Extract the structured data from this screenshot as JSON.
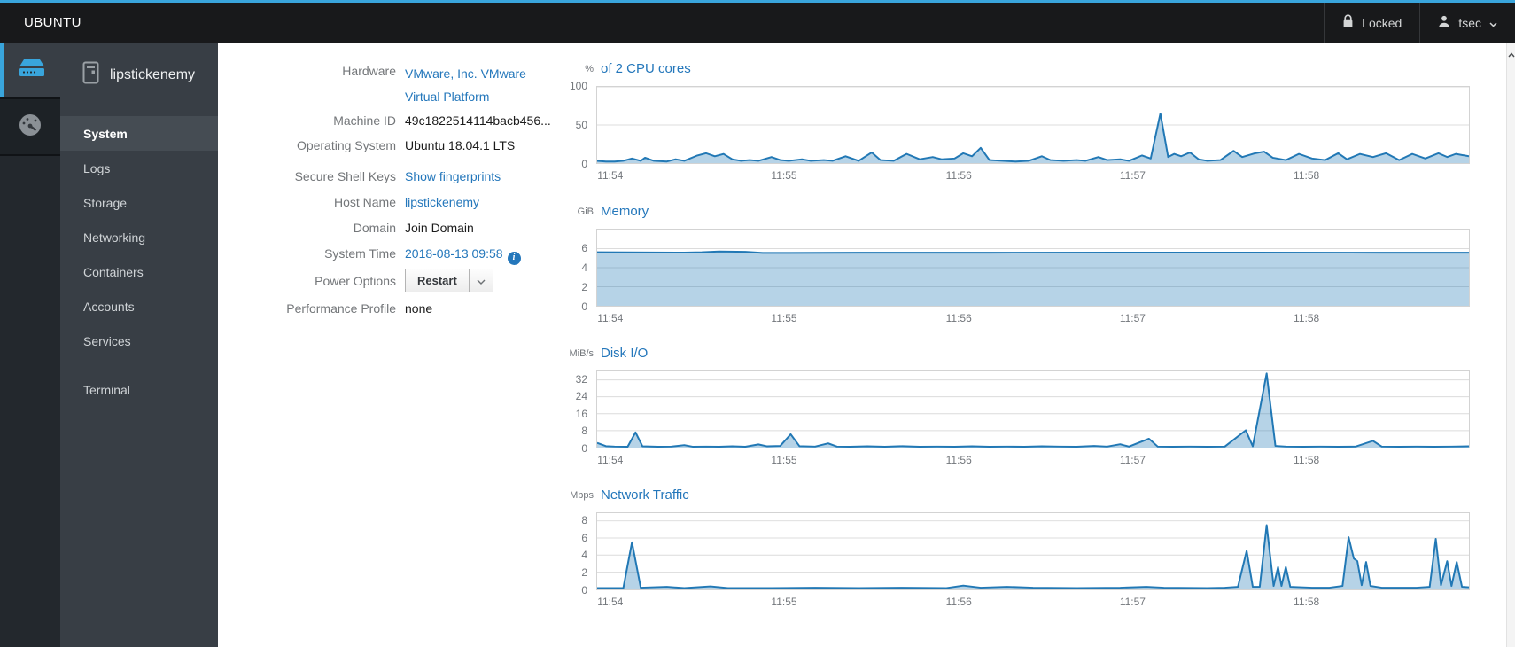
{
  "topbar": {
    "brand": "UBUNTU",
    "locked_label": "Locked",
    "user": "tsec"
  },
  "sidebar": {
    "hostname": "lipstickenemy",
    "items": [
      "System",
      "Logs",
      "Storage",
      "Networking",
      "Containers",
      "Accounts",
      "Services",
      "Terminal"
    ],
    "active_item": "System"
  },
  "info": {
    "hardware_label": "Hardware",
    "hardware_value": "VMware, Inc. VMware Virtual Platform",
    "machine_id_label": "Machine ID",
    "machine_id_value": "49c1822514114bacb456...",
    "os_label": "Operating System",
    "os_value": "Ubuntu 18.04.1 LTS",
    "ssh_label": "Secure Shell Keys",
    "ssh_value": "Show fingerprints",
    "hostname_label": "Host Name",
    "hostname_value": "lipstickenemy",
    "domain_label": "Domain",
    "domain_value": "Join Domain",
    "time_label": "System Time",
    "time_value": "2018-08-13 09:58",
    "power_label": "Power Options",
    "power_button": "Restart",
    "profile_label": "Performance Profile",
    "profile_value": "none"
  },
  "icons": {
    "info_glyph": "i"
  },
  "colors": {
    "accent_blue": "#39a5dc",
    "link_blue": "#2477bb",
    "chart_line": "#2178b5",
    "chart_fill": "rgba(33,120,181,0.33)"
  },
  "chart_data": [
    {
      "type": "area",
      "unit": "%",
      "title": "of 2 CPU cores",
      "ymax": 100,
      "yticks": [
        0,
        50,
        100
      ],
      "xticks": [
        {
          "label": "11:54",
          "f": 0.016
        },
        {
          "label": "11:55",
          "f": 0.215
        },
        {
          "label": "11:56",
          "f": 0.415
        },
        {
          "label": "11:57",
          "f": 0.614
        },
        {
          "label": "11:58",
          "f": 0.813
        }
      ],
      "line_color": "#2178b5",
      "fill_color": "rgba(33,120,181,0.33)",
      "series": [
        [
          0,
          3
        ],
        [
          0.01,
          2
        ],
        [
          0.02,
          2
        ],
        [
          0.03,
          3
        ],
        [
          0.04,
          6
        ],
        [
          0.05,
          3
        ],
        [
          0.055,
          7
        ],
        [
          0.065,
          3
        ],
        [
          0.08,
          2
        ],
        [
          0.09,
          5
        ],
        [
          0.1,
          3
        ],
        [
          0.115,
          10
        ],
        [
          0.125,
          13
        ],
        [
          0.135,
          9
        ],
        [
          0.145,
          12
        ],
        [
          0.155,
          5
        ],
        [
          0.165,
          3
        ],
        [
          0.175,
          4
        ],
        [
          0.185,
          3
        ],
        [
          0.2,
          8
        ],
        [
          0.21,
          4
        ],
        [
          0.22,
          3
        ],
        [
          0.235,
          5
        ],
        [
          0.245,
          3
        ],
        [
          0.26,
          4
        ],
        [
          0.27,
          3
        ],
        [
          0.285,
          9
        ],
        [
          0.3,
          3
        ],
        [
          0.315,
          14
        ],
        [
          0.325,
          4
        ],
        [
          0.34,
          3
        ],
        [
          0.355,
          12
        ],
        [
          0.37,
          5
        ],
        [
          0.385,
          8
        ],
        [
          0.395,
          5
        ],
        [
          0.41,
          6
        ],
        [
          0.42,
          13
        ],
        [
          0.43,
          9
        ],
        [
          0.44,
          20
        ],
        [
          0.45,
          4
        ],
        [
          0.465,
          3
        ],
        [
          0.48,
          2
        ],
        [
          0.495,
          3
        ],
        [
          0.51,
          9
        ],
        [
          0.52,
          4
        ],
        [
          0.535,
          3
        ],
        [
          0.55,
          4
        ],
        [
          0.56,
          3
        ],
        [
          0.575,
          8
        ],
        [
          0.585,
          4
        ],
        [
          0.6,
          5
        ],
        [
          0.61,
          3
        ],
        [
          0.625,
          10
        ],
        [
          0.635,
          6
        ],
        [
          0.646,
          65
        ],
        [
          0.655,
          8
        ],
        [
          0.662,
          12
        ],
        [
          0.67,
          9
        ],
        [
          0.68,
          14
        ],
        [
          0.69,
          5
        ],
        [
          0.7,
          3
        ],
        [
          0.715,
          4
        ],
        [
          0.73,
          16
        ],
        [
          0.74,
          8
        ],
        [
          0.755,
          13
        ],
        [
          0.765,
          15
        ],
        [
          0.775,
          7
        ],
        [
          0.79,
          4
        ],
        [
          0.805,
          12
        ],
        [
          0.82,
          6
        ],
        [
          0.835,
          4
        ],
        [
          0.85,
          13
        ],
        [
          0.86,
          5
        ],
        [
          0.875,
          12
        ],
        [
          0.89,
          8
        ],
        [
          0.905,
          13
        ],
        [
          0.92,
          4
        ],
        [
          0.935,
          12
        ],
        [
          0.95,
          6
        ],
        [
          0.965,
          13
        ],
        [
          0.975,
          8
        ],
        [
          0.985,
          12
        ],
        [
          1,
          9
        ]
      ]
    },
    {
      "type": "area",
      "unit": "GiB",
      "title": "Memory",
      "ymax": 8,
      "yticks": [
        0,
        2,
        4,
        6
      ],
      "xticks": [
        {
          "label": "11:54",
          "f": 0.016
        },
        {
          "label": "11:55",
          "f": 0.215
        },
        {
          "label": "11:56",
          "f": 0.415
        },
        {
          "label": "11:57",
          "f": 0.614
        },
        {
          "label": "11:58",
          "f": 0.813
        }
      ],
      "line_color": "#2178b5",
      "fill_color": "rgba(33,120,181,0.33)",
      "series": [
        [
          0,
          5.62
        ],
        [
          0.06,
          5.6
        ],
        [
          0.1,
          5.58
        ],
        [
          0.12,
          5.62
        ],
        [
          0.14,
          5.7
        ],
        [
          0.17,
          5.66
        ],
        [
          0.19,
          5.55
        ],
        [
          0.22,
          5.55
        ],
        [
          0.3,
          5.57
        ],
        [
          0.45,
          5.57
        ],
        [
          0.6,
          5.58
        ],
        [
          0.75,
          5.58
        ],
        [
          0.9,
          5.57
        ],
        [
          1,
          5.57
        ]
      ]
    },
    {
      "type": "area",
      "unit": "MiB/s",
      "title": "Disk I/O",
      "ymax": 36,
      "yticks": [
        0,
        8,
        16,
        24,
        32
      ],
      "xticks": [
        {
          "label": "11:54",
          "f": 0.016
        },
        {
          "label": "11:55",
          "f": 0.215
        },
        {
          "label": "11:56",
          "f": 0.415
        },
        {
          "label": "11:57",
          "f": 0.614
        },
        {
          "label": "11:58",
          "f": 0.813
        }
      ],
      "line_color": "#2178b5",
      "fill_color": "rgba(33,120,181,0.33)",
      "series": [
        [
          0,
          2.2
        ],
        [
          0.01,
          0.7
        ],
        [
          0.02,
          0.5
        ],
        [
          0.035,
          0.4
        ],
        [
          0.044,
          7.2
        ],
        [
          0.052,
          0.6
        ],
        [
          0.07,
          0.4
        ],
        [
          0.085,
          0.5
        ],
        [
          0.1,
          1.2
        ],
        [
          0.11,
          0.4
        ],
        [
          0.125,
          0.5
        ],
        [
          0.14,
          0.4
        ],
        [
          0.155,
          0.6
        ],
        [
          0.17,
          0.4
        ],
        [
          0.185,
          1.5
        ],
        [
          0.195,
          0.6
        ],
        [
          0.21,
          0.8
        ],
        [
          0.222,
          6.3
        ],
        [
          0.232,
          0.7
        ],
        [
          0.25,
          0.5
        ],
        [
          0.265,
          2
        ],
        [
          0.275,
          0.5
        ],
        [
          0.29,
          0.4
        ],
        [
          0.31,
          0.6
        ],
        [
          0.33,
          0.4
        ],
        [
          0.35,
          0.7
        ],
        [
          0.37,
          0.4
        ],
        [
          0.39,
          0.5
        ],
        [
          0.41,
          0.4
        ],
        [
          0.43,
          0.6
        ],
        [
          0.45,
          0.4
        ],
        [
          0.47,
          0.5
        ],
        [
          0.49,
          0.4
        ],
        [
          0.51,
          0.6
        ],
        [
          0.53,
          0.5
        ],
        [
          0.55,
          0.4
        ],
        [
          0.57,
          0.8
        ],
        [
          0.585,
          0.5
        ],
        [
          0.6,
          1.6
        ],
        [
          0.61,
          0.5
        ],
        [
          0.633,
          4.2
        ],
        [
          0.643,
          0.5
        ],
        [
          0.66,
          0.4
        ],
        [
          0.68,
          0.5
        ],
        [
          0.7,
          0.4
        ],
        [
          0.72,
          0.5
        ],
        [
          0.744,
          8.2
        ],
        [
          0.752,
          0.6
        ],
        [
          0.768,
          35
        ],
        [
          0.778,
          0.8
        ],
        [
          0.79,
          0.5
        ],
        [
          0.81,
          0.4
        ],
        [
          0.83,
          0.5
        ],
        [
          0.85,
          0.4
        ],
        [
          0.87,
          0.5
        ],
        [
          0.89,
          3.2
        ],
        [
          0.9,
          0.5
        ],
        [
          0.92,
          0.4
        ],
        [
          0.94,
          0.5
        ],
        [
          0.96,
          0.4
        ],
        [
          0.98,
          0.5
        ],
        [
          1,
          0.6
        ]
      ]
    },
    {
      "type": "area",
      "unit": "Mbps",
      "title": "Network Traffic",
      "ymax": 8.9,
      "yticks": [
        0,
        2,
        4,
        6,
        8
      ],
      "xticks": [
        {
          "label": "11:54",
          "f": 0.016
        },
        {
          "label": "11:55",
          "f": 0.215
        },
        {
          "label": "11:56",
          "f": 0.415
        },
        {
          "label": "11:57",
          "f": 0.614
        },
        {
          "label": "11:58",
          "f": 0.813
        }
      ],
      "line_color": "#2178b5",
      "fill_color": "rgba(33,120,181,0.33)",
      "series": [
        [
          0,
          0.15
        ],
        [
          0.03,
          0.15
        ],
        [
          0.04,
          5.5
        ],
        [
          0.05,
          0.2
        ],
        [
          0.08,
          0.3
        ],
        [
          0.1,
          0.15
        ],
        [
          0.13,
          0.35
        ],
        [
          0.15,
          0.15
        ],
        [
          0.2,
          0.15
        ],
        [
          0.25,
          0.2
        ],
        [
          0.3,
          0.15
        ],
        [
          0.35,
          0.2
        ],
        [
          0.4,
          0.15
        ],
        [
          0.42,
          0.45
        ],
        [
          0.44,
          0.2
        ],
        [
          0.47,
          0.3
        ],
        [
          0.5,
          0.2
        ],
        [
          0.55,
          0.15
        ],
        [
          0.6,
          0.2
        ],
        [
          0.63,
          0.3
        ],
        [
          0.65,
          0.2
        ],
        [
          0.7,
          0.15
        ],
        [
          0.72,
          0.2
        ],
        [
          0.735,
          0.3
        ],
        [
          0.745,
          4.5
        ],
        [
          0.752,
          0.3
        ],
        [
          0.76,
          0.3
        ],
        [
          0.768,
          7.5
        ],
        [
          0.776,
          0.4
        ],
        [
          0.781,
          2.6
        ],
        [
          0.785,
          0.4
        ],
        [
          0.79,
          2.6
        ],
        [
          0.795,
          0.3
        ],
        [
          0.82,
          0.2
        ],
        [
          0.84,
          0.2
        ],
        [
          0.855,
          0.4
        ],
        [
          0.862,
          6.1
        ],
        [
          0.868,
          3.6
        ],
        [
          0.872,
          3.3
        ],
        [
          0.877,
          0.5
        ],
        [
          0.882,
          3.2
        ],
        [
          0.887,
          0.4
        ],
        [
          0.9,
          0.2
        ],
        [
          0.92,
          0.2
        ],
        [
          0.94,
          0.2
        ],
        [
          0.955,
          0.3
        ],
        [
          0.962,
          5.9
        ],
        [
          0.968,
          0.5
        ],
        [
          0.975,
          3.3
        ],
        [
          0.98,
          0.4
        ],
        [
          0.986,
          3.2
        ],
        [
          0.992,
          0.3
        ],
        [
          1,
          0.25
        ]
      ]
    }
  ]
}
